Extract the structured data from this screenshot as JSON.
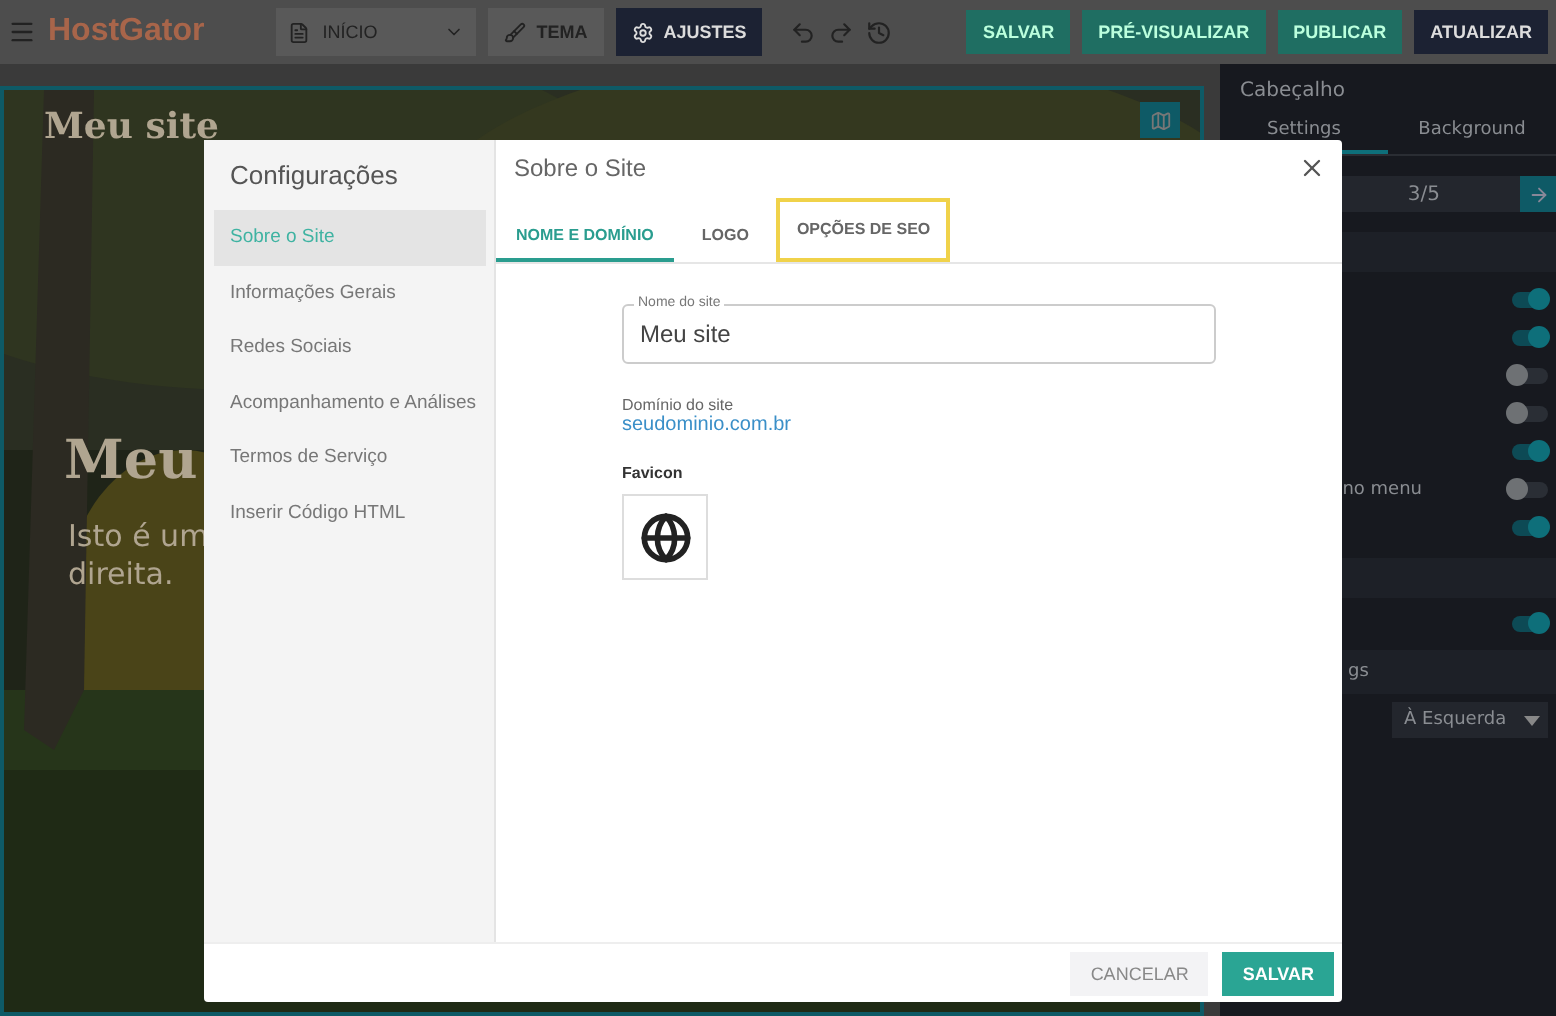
{
  "toolbar": {
    "logo": "HostGator",
    "page_select": "INÍCIO",
    "buttons": [
      {
        "label": "TEMA",
        "kind": "brush",
        "selected": false
      },
      {
        "label": "AJUSTES",
        "kind": "gear",
        "selected": true
      }
    ],
    "actions": [
      {
        "label": "SALVAR",
        "kind": "primary"
      },
      {
        "label": "PRÉ-VISUALIZAR",
        "kind": "primary"
      },
      {
        "label": "PUBLICAR",
        "kind": "primary"
      },
      {
        "label": "ATUALIZAR",
        "kind": "dark"
      }
    ]
  },
  "canvas": {
    "site_title": "Meu site",
    "hero_title": "Meu",
    "hero_text": [
      "Isto é um",
      "direita."
    ]
  },
  "right_panel": {
    "title": "Cabeçalho",
    "tabs": [
      {
        "label": "Settings",
        "selected": true
      },
      {
        "label": "Background",
        "selected": false
      }
    ],
    "pager": "3/5",
    "toggles": [
      {
        "on": true
      },
      {
        "on": true
      },
      {
        "on": false
      },
      {
        "on": false
      },
      {
        "on": true
      },
      {
        "label": "no menu",
        "on": false
      },
      {
        "on": true
      }
    ],
    "toggles_2": [
      {
        "on": true
      }
    ],
    "section_label": "gs",
    "select": "À Esquerda"
  },
  "dialog": {
    "sidebar_title": "Configurações",
    "sidebar_items": [
      {
        "label": "Sobre o Site",
        "selected": true
      },
      {
        "label": "Informações Gerais",
        "selected": false
      },
      {
        "label": "Redes Sociais",
        "selected": false
      },
      {
        "label": "Acompanhamento e Análises",
        "selected": false
      },
      {
        "label": "Termos de Serviço",
        "selected": false
      },
      {
        "label": "Inserir Código HTML",
        "selected": false
      }
    ],
    "title": "Sobre o Site",
    "tabs": [
      {
        "label": "NOME E DOMÍNIO",
        "selected": true,
        "highlighted": false
      },
      {
        "label": "LOGO",
        "selected": false,
        "highlighted": false
      },
      {
        "label": "OPÇÕES DE SEO",
        "selected": false,
        "highlighted": true
      }
    ],
    "site_name": {
      "label": "Nome do site",
      "value": "Meu site"
    },
    "domain_label": "Domínio do site",
    "domain": "seudominio.com.br",
    "favicon_label": "Favicon",
    "buttons": [
      {
        "label": "CANCELAR",
        "kind": "secondary"
      },
      {
        "label": "SALVAR",
        "kind": "primary"
      }
    ]
  }
}
